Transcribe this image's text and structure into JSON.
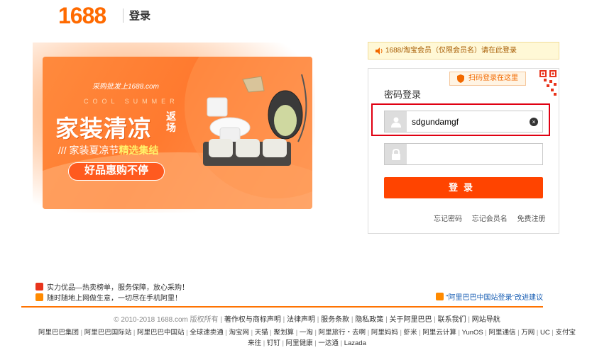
{
  "header": {
    "logo": "1688",
    "title": "登录"
  },
  "banner": {
    "site": "采购批发上1688.com",
    "summer": "COOL SUMMER",
    "headline": "家装清凉",
    "scene": "返场",
    "sub_prefix": "/// 家装夏凉节",
    "sub_highlight": "精选集结",
    "button": "好品惠购不停"
  },
  "notice": {
    "text": "1688/淘宝会员（仅限会员名）请在此登录"
  },
  "login": {
    "qr_tip": "扫码登录在这里",
    "title": "密码登录",
    "username_value": "sdgundamgf",
    "password_value": "",
    "clear_label": "×",
    "submit": "登录",
    "links": [
      "忘记密码",
      "忘记会员名",
      "免费注册"
    ]
  },
  "promos": [
    "实力优品—热卖榜单，服务保障，放心采购！",
    "随时随地上网做生意，一切尽在手机阿里！"
  ],
  "feedback": "\"阿里巴巴中国站登录\"改进建议",
  "copyright": {
    "prefix": "© 2010-2018 1688.com 版权所有",
    "links": [
      "著作权与商标声明",
      "法律声明",
      "服务条款",
      "隐私政策",
      "关于阿里巴巴",
      "联系我们",
      "网站导航"
    ]
  },
  "footer": {
    "row1": [
      "阿里巴巴集团",
      "阿里巴巴国际站",
      "阿里巴巴中国站",
      "全球速卖通",
      "淘宝网",
      "天猫",
      "聚划算",
      "一淘",
      "阿里旅行・去啊",
      "阿里妈妈",
      "虾米",
      "阿里云计算",
      "YunOS",
      "阿里通信",
      "万网",
      "UC",
      "支付宝"
    ],
    "row2": [
      "来往",
      "钉钉",
      "阿里健康",
      "一达通",
      "Lazada"
    ]
  },
  "colors": {
    "brand": "#ff6a00",
    "login_button": "#ff4400",
    "highlight": "#e00012",
    "link_blue": "#1a5fb4"
  }
}
